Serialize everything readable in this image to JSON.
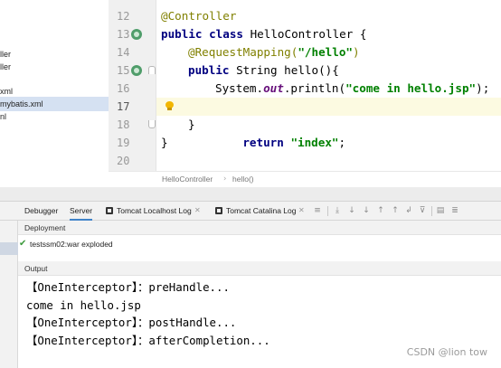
{
  "project_tree": {
    "items": [
      {
        "text": "ller",
        "selected": false
      },
      {
        "text": "ller",
        "selected": false
      },
      {
        "text": "xml",
        "selected": false
      },
      {
        "text": "mybatis.xml",
        "selected": true
      },
      {
        "text": "nl",
        "selected": false
      }
    ]
  },
  "editor": {
    "line_numbers": [
      "12",
      "13",
      "14",
      "15",
      "16",
      "17",
      "18",
      "19",
      "20"
    ],
    "current_line": "17",
    "code": {
      "l12_annotation": "@Controller",
      "l13_public": "public",
      "l13_class": "class",
      "l13_rest": " HelloController {",
      "l14_annotation": "@RequestMapping(",
      "l14_string": "\"/hello\"",
      "l14_close": ")",
      "l15_public": "public",
      "l15_rest": " String hello(){",
      "l16_prefix": "System.",
      "l16_field": "out",
      "l16_mid": ".println(",
      "l16_string": "\"come in hello.jsp\"",
      "l16_close": ");",
      "l17_return": "return",
      "l17_string": "\"index\"",
      "l17_semi": ";",
      "l18_brace": "}",
      "l19_brace": "}"
    }
  },
  "breadcrumb": {
    "items": [
      "HelloController",
      "hello()"
    ],
    "separator": "›"
  },
  "run_panel": {
    "tabs": [
      {
        "label": "Debugger",
        "active": false
      },
      {
        "label": "Server",
        "active": true
      },
      {
        "label": "Tomcat Localhost Log",
        "active": false
      },
      {
        "label": "Tomcat Catalina Log",
        "active": false
      }
    ],
    "toolbar_icons": [
      "menu-icon",
      "scroll-to-end-icon",
      "download-icon",
      "download-icon",
      "upload-icon",
      "upload-icon",
      "soft-wrap-icon",
      "filter-icon",
      "print-icon",
      "settings-icon"
    ],
    "deployment": {
      "header": "Deployment",
      "artifact": "testssm02:war exploded",
      "status_color": "#3c9a3c"
    },
    "output": {
      "header": "Output",
      "lines": [
        "【OneInterceptor】：preHandle...",
        "come in hello.jsp",
        "【OneInterceptor】：postHandle...",
        "【OneInterceptor】：afterCompletion..."
      ]
    }
  },
  "watermark": "CSDN @lion tow",
  "colors": {
    "annotation": "#808000",
    "keyword": "#000080",
    "string": "#008000",
    "static_field": "#660e7a",
    "current_line": "#fcfae1",
    "selection": "#d5e1f2",
    "active_tab_underline": "#4083c9"
  }
}
